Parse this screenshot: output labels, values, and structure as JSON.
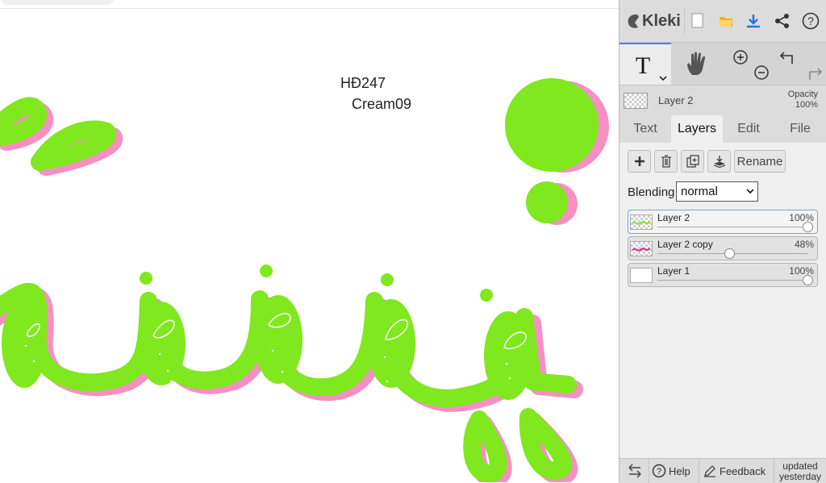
{
  "canvas": {
    "texts": [
      "HĐ247",
      "Cream09"
    ]
  },
  "colors": {
    "stroke_green": "#7fe81e",
    "shadow_pink": "#f68fc4",
    "accent_blue": "#3b8be0"
  },
  "app": {
    "logo_text": "Kleki",
    "top_icons": [
      "new-image-icon",
      "open-folder-icon",
      "download-icon",
      "share-icon",
      "help-circle-icon"
    ]
  },
  "tools": {
    "active": "text",
    "items": [
      "text-tool-icon",
      "hand-tool-icon",
      "zoom-in-icon",
      "zoom-out-icon",
      "undo-icon",
      "redo-icon"
    ]
  },
  "layer_info": {
    "name": "Layer 2",
    "opacity_label": "Opacity",
    "opacity_value": "100%"
  },
  "tabs": [
    "Text",
    "Layers",
    "Edit",
    "File"
  ],
  "active_tab": "Layers",
  "layers_panel": {
    "buttons": {
      "add_icon": "plus-icon",
      "delete_icon": "trash-icon",
      "duplicate_icon": "duplicate-icon",
      "merge_icon": "merge-down-icon",
      "rename_label": "Rename"
    },
    "blending_label": "Blending",
    "blending_value": "normal",
    "layers": [
      {
        "name": "Layer 2",
        "opacity_label": "100%",
        "opacity": 1.0,
        "selected": true
      },
      {
        "name": "Layer 2 copy",
        "opacity_label": "48%",
        "opacity": 0.48,
        "selected": false
      },
      {
        "name": "Layer 1",
        "opacity_label": "100%",
        "opacity": 1.0,
        "selected": false
      }
    ]
  },
  "bottom_bar": {
    "swap_icon": "swap-arrows-icon",
    "help_label": "Help",
    "feedback_label": "Feedback",
    "updated_line1": "updated",
    "updated_line2": "yesterday"
  }
}
